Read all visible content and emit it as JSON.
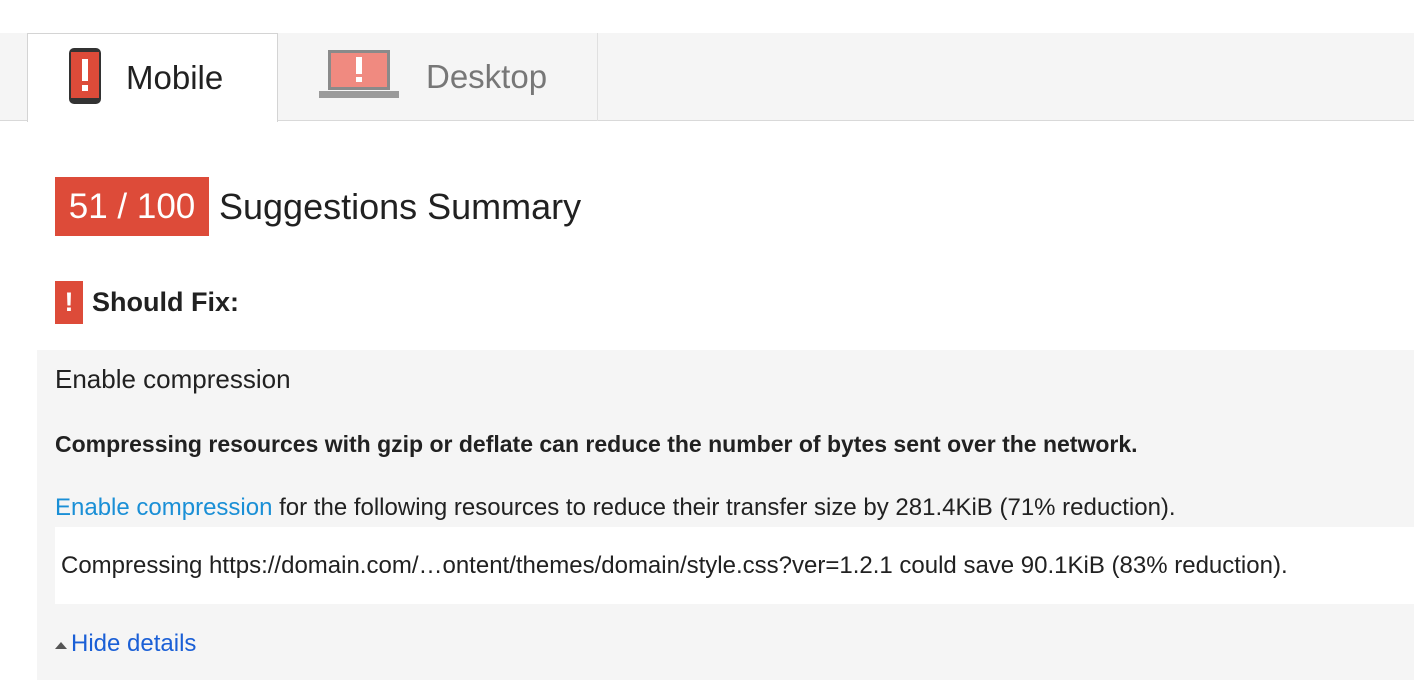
{
  "tabs": [
    {
      "label": "Mobile",
      "icon": "mobile-phone-warning-icon",
      "active": true
    },
    {
      "label": "Desktop",
      "icon": "laptop-warning-icon",
      "active": false
    }
  ],
  "score": {
    "value": "51 / 100",
    "title": "Suggestions Summary",
    "color": "#dd4b39"
  },
  "section": {
    "icon": "!",
    "label": "Should Fix:"
  },
  "rule": {
    "title": "Enable compression",
    "summary": "Compressing resources with gzip or deflate can reduce the number of bytes sent over the network.",
    "link_text": "Enable compression",
    "desc_rest": " for the following resources to reduce their transfer size by 281.4KiB (71% reduction).",
    "resource": "Compressing https://domain.com/…ontent/themes/domain/style.css?ver=1.2.1 could save 90.1KiB (83% reduction).",
    "hide_details": "Hide details"
  },
  "colors": {
    "accent": "#dd4b39",
    "link": "#1a8fd6"
  }
}
